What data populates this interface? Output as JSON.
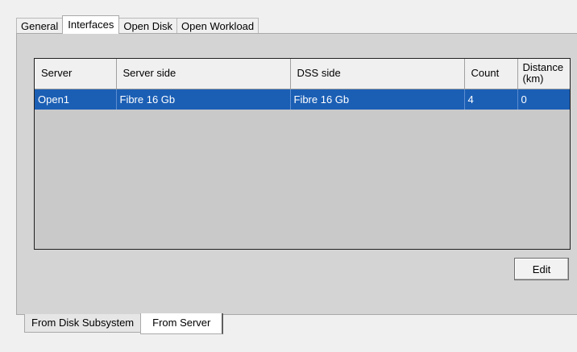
{
  "top_tabs": [
    "General",
    "Interfaces",
    "Open Disk",
    "Open Workload"
  ],
  "active_top_tab": "Interfaces",
  "table": {
    "columns": [
      "Server",
      "Server side",
      "DSS side",
      "Count",
      "Distance (km)"
    ],
    "rows": [
      [
        "Open1",
        "Fibre 16 Gb",
        "Fibre 16 Gb",
        "4",
        "0"
      ]
    ],
    "selected_row_color": "#1b5fb5"
  },
  "edit_button": "Edit",
  "bottom_tabs": [
    "From Disk Subsystem",
    "From Server"
  ],
  "active_bottom_tab": "From Server"
}
